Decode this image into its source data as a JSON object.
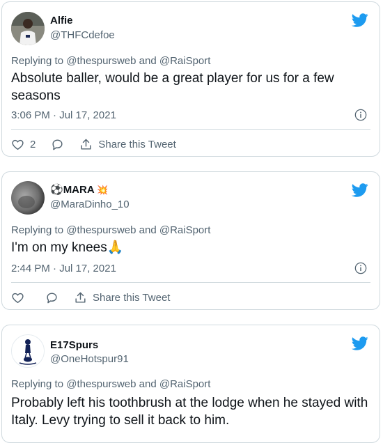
{
  "colors": {
    "border": "#cfd9de",
    "muted": "#536471",
    "twitter_blue": "#1d9bf0",
    "text": "#0f1419"
  },
  "tweets": [
    {
      "name": "Alfie",
      "handle": "@THFCdefoe",
      "replying": "Replying to @thespursweb and @RaiSport",
      "text": "Absolute baller, would be a great player for us for a few seasons",
      "time": "3:06 PM · Jul 17, 2021",
      "like_count": "2",
      "share_label": "Share this Tweet"
    },
    {
      "name_prefix": "⚽",
      "name": "MARA",
      "name_suffix": "💥",
      "handle": "@MaraDinho_10",
      "replying": "Replying to @thespursweb and @RaiSport",
      "text": "I'm on my knees🙏",
      "time": "2:44 PM · Jul 17, 2021",
      "share_label": "Share this Tweet"
    },
    {
      "name": "E17Spurs",
      "handle": "@OneHotspur91",
      "replying": "Replying to @thespursweb and @RaiSport",
      "text": "Probably left his toothbrush at the lodge when he stayed with Italy. Levy trying to sell it back to him."
    }
  ],
  "icons": {
    "twitter": "twitter-bird-icon",
    "info": "info-icon",
    "like": "heart-icon",
    "reply": "reply-bubble-icon",
    "share": "share-icon"
  }
}
